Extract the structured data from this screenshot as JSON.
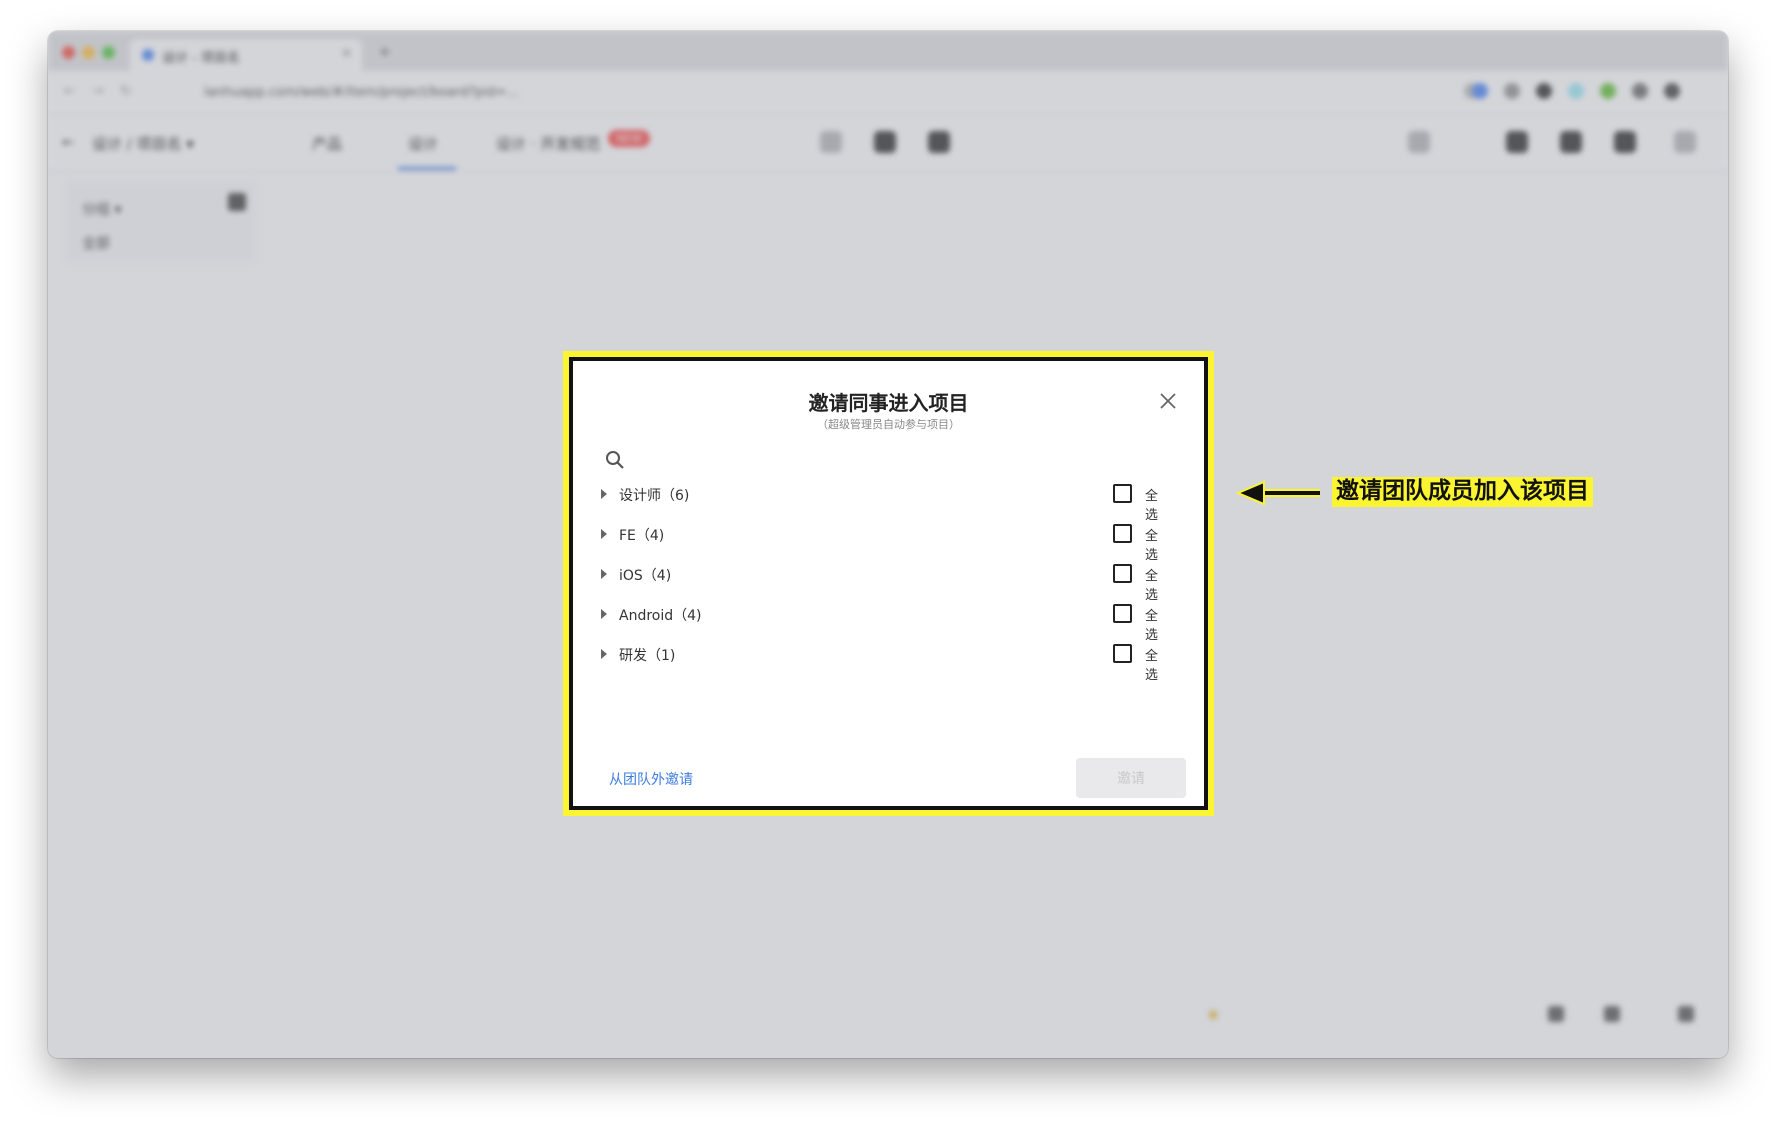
{
  "browser": {
    "tab_title": "设计 - 项目名",
    "tab_close": "×",
    "new_tab": "+",
    "url": "lanhuapp.com/web/#/item/project/board?pid=..."
  },
  "app_toolbar": {
    "project_name": "设计 / 项目名 ▾",
    "tab_product": "产品",
    "tab_design": "设计",
    "tab_design_spec": "设计 · 开发规范",
    "badge": "NEW"
  },
  "side_panel": {
    "row1": "分组 ▾",
    "row2": "全部"
  },
  "dialog": {
    "title": "邀请同事进入项目",
    "subtitle": "（超级管理员自动参与项目）",
    "search_placeholder": "",
    "select_all_label": "全选",
    "groups": [
      {
        "label": "设计师（6)"
      },
      {
        "label": "FE（4)"
      },
      {
        "label": "iOS（4)"
      },
      {
        "label": "Android（4)"
      },
      {
        "label": "研发（1)"
      }
    ],
    "outside_link": "从团队外邀请",
    "invite_button": "邀请"
  },
  "annotation": {
    "text": "邀请团队成员加入该项目"
  },
  "colors": {
    "highlight": "#fbf531",
    "link": "#3d7de0",
    "overlay": "#d6d8dc"
  }
}
